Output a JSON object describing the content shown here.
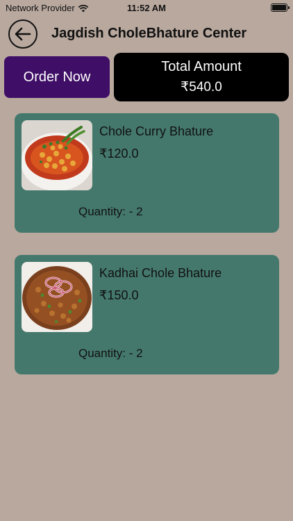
{
  "status_bar": {
    "carrier": "Network Provider",
    "time": "11:52 AM"
  },
  "header": {
    "title": "Jagdish CholeBhature Center"
  },
  "actions": {
    "order_now_label": "Order Now"
  },
  "total": {
    "label": "Total Amount",
    "value": "₹540.0"
  },
  "items": [
    {
      "name": "Chole Curry Bhature",
      "price": "₹120.0",
      "quantity": "Quantity: - 2",
      "image": "chole-curry-bowl-image"
    },
    {
      "name": "Kadhai Chole Bhature",
      "price": "₹150.0",
      "quantity": "Quantity: - 2",
      "image": "kadhai-chole-plate-image"
    }
  ],
  "colors": {
    "background": "#b8a89e",
    "order_button": "#3f0e66",
    "total_box": "#000000",
    "card": "#44786c"
  }
}
